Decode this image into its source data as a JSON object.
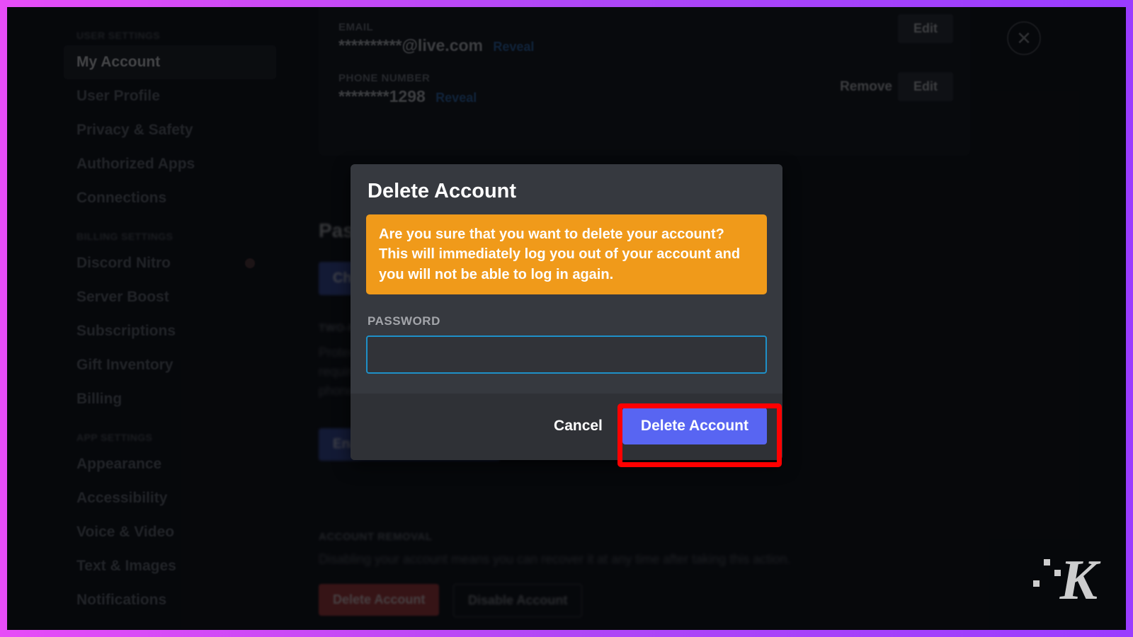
{
  "sidebar": {
    "sections": [
      {
        "label": "USER SETTINGS",
        "items": [
          {
            "label": "My Account",
            "active": true
          },
          {
            "label": "User Profile"
          },
          {
            "label": "Privacy & Safety"
          },
          {
            "label": "Authorized Apps"
          },
          {
            "label": "Connections"
          }
        ]
      },
      {
        "label": "BILLING SETTINGS",
        "items": [
          {
            "label": "Discord Nitro",
            "badge": true
          },
          {
            "label": "Server Boost"
          },
          {
            "label": "Subscriptions"
          },
          {
            "label": "Gift Inventory"
          },
          {
            "label": "Billing"
          }
        ]
      },
      {
        "label": "APP SETTINGS",
        "items": [
          {
            "label": "Appearance"
          },
          {
            "label": "Accessibility"
          },
          {
            "label": "Voice & Video"
          },
          {
            "label": "Text & Images"
          },
          {
            "label": "Notifications"
          }
        ]
      }
    ]
  },
  "account": {
    "email_label": "EMAIL",
    "email_value": "**********@live.com",
    "reveal": "Reveal",
    "phone_label": "PHONE NUMBER",
    "phone_value": "********1298",
    "edit": "Edit",
    "remove": "Remove"
  },
  "password_section": {
    "title": "Password and Authentication",
    "change_btn": "Change Password",
    "twofa_label": "TWO-FACTOR AUTHENTICATION",
    "twofa_desc": "Protect your account with an extra layer of security. Once configured, you'll be required to enter both your password and an authentication code from your mobile phone in order to sign in.",
    "enable_btn": "Enable Two-Factor Auth"
  },
  "removal_section": {
    "label": "ACCOUNT REMOVAL",
    "desc": "Disabling your account means you can recover it at any time after taking this action.",
    "delete_btn": "Delete Account",
    "disable_btn": "Disable Account"
  },
  "modal": {
    "title": "Delete Account",
    "warning": "Are you sure that you want to delete your account? This will immediately log you out of your account and you will not be able to log in again.",
    "password_label": "PASSWORD",
    "cancel": "Cancel",
    "confirm": "Delete Account"
  },
  "close_x": "✕"
}
